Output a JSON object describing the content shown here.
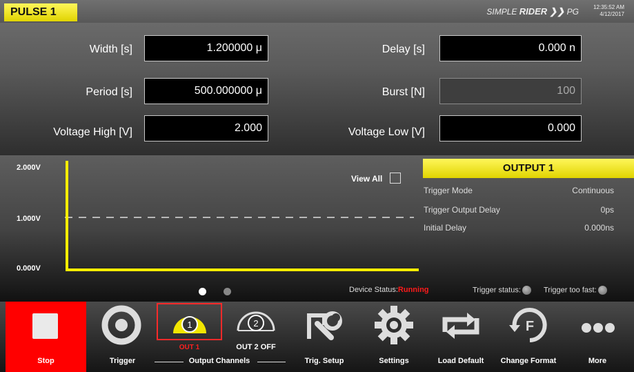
{
  "header": {
    "tab_title": "PULSE 1",
    "brand_simple": "SIMPLE",
    "brand_rider": "RIDER",
    "brand_suffix": "PG",
    "time": "12:35:52 AM",
    "date": "4/12/2017"
  },
  "params": {
    "width_label": "Width [s]",
    "width_value": "1.200000 μ",
    "delay_label": "Delay [s]",
    "delay_value": "0.000 n",
    "period_label": "Period [s]",
    "period_value": "500.000000 μ",
    "burst_label": "Burst [N]",
    "burst_value": "100",
    "vhigh_label": "Voltage High [V]",
    "vhigh_value": "2.000",
    "vlow_label": "Voltage Low [V]",
    "vlow_value": "0.000"
  },
  "scope": {
    "y_top": "2.000V",
    "y_mid": "1.000V",
    "y_bottom": "0.000V",
    "view_all": "View All",
    "trace_color": "#ffee00"
  },
  "output_panel": {
    "title": "OUTPUT 1",
    "rows": [
      {
        "label": "Trigger Mode",
        "value": "Continuous"
      },
      {
        "label": "Trigger Output Delay",
        "value": "0ps"
      },
      {
        "label": "Initial Delay",
        "value": "0.000ns"
      }
    ]
  },
  "status": {
    "device_status_label": "Device Status:",
    "device_status_value": "Running",
    "trigger_status_label": "Trigger status:",
    "trigger_too_fast_label": "Trigger too fast:"
  },
  "toolbar": {
    "stop": "Stop",
    "trigger": "Trigger",
    "out1_label": "OUT 1",
    "out1_num": "1",
    "out2_label": "OUT 2 OFF",
    "out2_num": "2",
    "output_channels": "Output Channels",
    "trig_setup": "Trig. Setup",
    "settings": "Settings",
    "load_default": "Load Default",
    "change_format": "Change Format",
    "more": "More"
  },
  "colors": {
    "accent_yellow": "#f2e600",
    "stop_red": "#ff0000",
    "status_red": "#ff1a1a"
  }
}
